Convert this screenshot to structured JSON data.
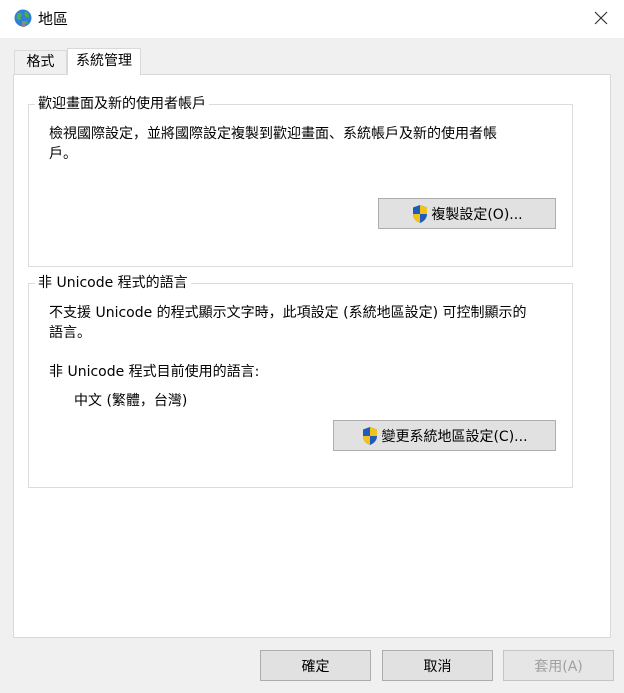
{
  "window": {
    "title": "地區",
    "icon": "globe-icon",
    "close_icon": "close-icon"
  },
  "tabs": [
    {
      "label": "格式",
      "selected": false
    },
    {
      "label": "系統管理",
      "selected": true
    }
  ],
  "welcome_group": {
    "legend": "歡迎畫面及新的使用者帳戶",
    "description_line1": "檢視國際設定，並將國際設定複製到歡迎畫面、系統帳戶及新的使用者帳",
    "description_line2": "戶。",
    "copy_button_label": "複製設定(O)..."
  },
  "nonunicode_group": {
    "legend": "非 Unicode 程式的語言",
    "description_line1": "不支援 Unicode 的程式顯示文字時，此項設定 (系統地區設定) 可控制顯示的",
    "description_line2": "語言。",
    "current_label": "非 Unicode 程式目前使用的語言:",
    "current_value": "中文 (繁體，台灣)",
    "change_button_label": "變更系統地區設定(C)..."
  },
  "footer": {
    "ok_label": "確定",
    "cancel_label": "取消",
    "apply_label": "套用(A)",
    "apply_disabled": true
  },
  "colors": {
    "shield_blue": "#1f5bb8",
    "shield_yellow": "#f2c21a"
  }
}
